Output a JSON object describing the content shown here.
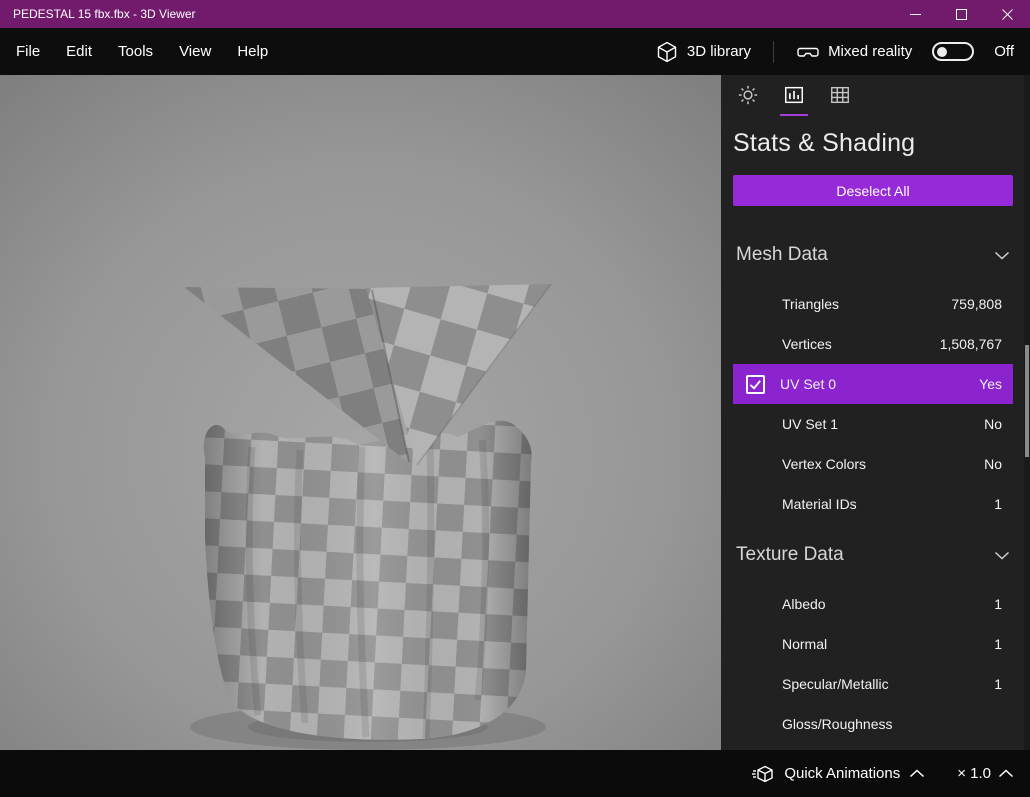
{
  "window": {
    "title": "PEDESTAL 15 fbx.fbx - 3D Viewer"
  },
  "menu": {
    "items": [
      "File",
      "Edit",
      "Tools",
      "View",
      "Help"
    ],
    "library_label": "3D library",
    "mixed_reality": {
      "label": "Mixed reality",
      "state_label": "Off",
      "enabled": false
    }
  },
  "panel": {
    "title": "Stats & Shading",
    "deselect_button": "Deselect All",
    "sections": [
      {
        "title": "Mesh Data",
        "rows": [
          {
            "label": "Triangles",
            "value": "759,808"
          },
          {
            "label": "Vertices",
            "value": "1,508,767"
          },
          {
            "label": "UV Set 0",
            "value": "Yes",
            "selected": true,
            "checked": true
          },
          {
            "label": "UV Set 1",
            "value": "No"
          },
          {
            "label": "Vertex Colors",
            "value": "No"
          },
          {
            "label": "Material IDs",
            "value": "1"
          }
        ]
      },
      {
        "title": "Texture Data",
        "rows": [
          {
            "label": "Albedo",
            "value": "1"
          },
          {
            "label": "Normal",
            "value": "1"
          },
          {
            "label": "Specular/Metallic",
            "value": "1"
          },
          {
            "label": "Gloss/Roughness",
            "value": ""
          }
        ]
      }
    ]
  },
  "bottom_bar": {
    "quick_animations_label": "Quick Animations",
    "speed_label": "× 1.0"
  },
  "icons": {
    "library": "3d-cube-icon",
    "mixed_reality": "headset-icon",
    "tab_1": "sun-lighting-icon",
    "tab_2": "stats-chart-icon",
    "tab_3": "wireframe-grid-icon",
    "section": "chevron-down-icon",
    "bottom": "chevron-up-icon",
    "quick_animations": "animated-cube-icon",
    "uv_checkbox": "checkbox-checked-icon",
    "window": [
      "minimize-icon",
      "maximize-icon",
      "close-icon"
    ]
  },
  "colors": {
    "titlebar": "#721a6c",
    "accent_button": "#9629d8",
    "selected_row": "#8b24cf",
    "tab_underline": "#a43ddb",
    "panel_bg": "#212121",
    "menubar_bg": "#0d0d0d"
  }
}
